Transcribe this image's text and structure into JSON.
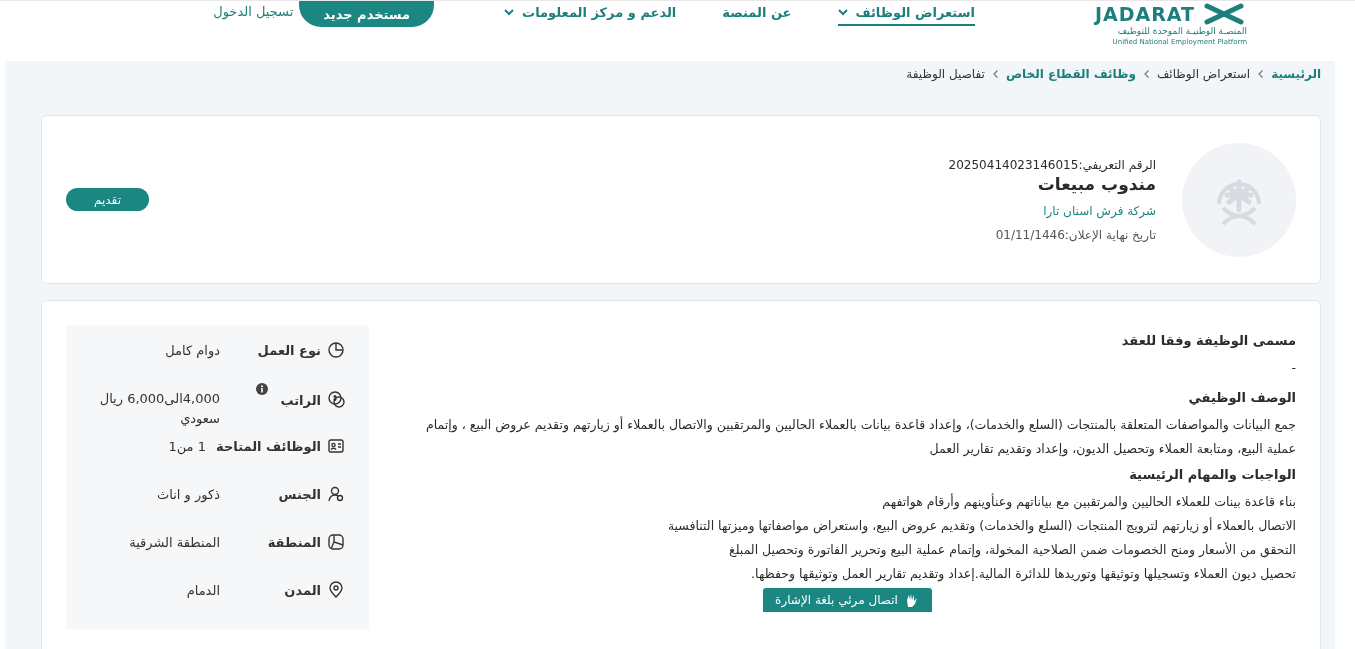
{
  "header": {
    "logo": {
      "wordmark": "JADARAT",
      "arabic": "المنصـة الوطنيـة الموحدة للتوظيف",
      "english": "Unified National Employment Platform"
    },
    "nav": [
      {
        "label": "استعراض الوظائف",
        "dropdown": true,
        "selected": true
      },
      {
        "label": "عن المنصة",
        "dropdown": false,
        "selected": false
      },
      {
        "label": "الدعم و مركز المعلومات",
        "dropdown": true,
        "selected": false
      }
    ],
    "register_button": "مستخدم جديد",
    "login_link": "تسجيل الدخول"
  },
  "breadcrumb": [
    {
      "label": "الرئيسية",
      "link": true
    },
    {
      "label": "استعراض الوظائف",
      "link": false
    },
    {
      "label": "وظائف القطاع الخاص",
      "link": true
    },
    {
      "label": "تفاصيل الوظيفة",
      "link": false
    }
  ],
  "job": {
    "id": "الرقم التعريفي:20250414023146015",
    "title": "مندوب مبيعات",
    "company": "شركة فرش اسنان تارا",
    "deadline": "تاريخ نهاية الإعلان:01/11/1446",
    "apply_button": "تقديم"
  },
  "details": [
    {
      "kind": "work_type",
      "label": "نوع العمل",
      "value": "دوام كامل",
      "info": false
    },
    {
      "kind": "salary",
      "label": "الراتب",
      "value": "4,000الى6,000 ريال سعودي",
      "info": true
    },
    {
      "kind": "vacancies",
      "label": "الوظائف المتاحة",
      "value": "1 من1",
      "info": false
    },
    {
      "kind": "gender",
      "label": "الجنس",
      "value": "ذكور و اناث",
      "info": false
    },
    {
      "kind": "region",
      "label": "المنطقة",
      "value": "المنطقة الشرقية",
      "info": false
    },
    {
      "kind": "city",
      "label": "المدن",
      "value": "الدمام",
      "info": false
    }
  ],
  "sections": [
    {
      "heading": "مسمى الوظيفة وفقا للعقد",
      "lines": [
        "-"
      ]
    },
    {
      "heading": "الوصف الوظيفي",
      "lines": [
        "جمع البيانات والمواصفات المتعلقة بالمنتجات (السلع والخدمات)، وإعداد قاعدة بيانات بالعملاء الحاليين والمرتقبين والاتصال بالعملاء أو زيارتهم وتقديم عروض البيع ، وإتمام عملية البيع، ومتابعة العملاء وتحصيل الديون، وإعداد وتقديم تقارير العمل"
      ]
    },
    {
      "heading": "الواجبات والمهام الرئيسية",
      "lines": [
        "بناء قاعدة بينات للعملاء الحاليين والمرتقبين مع بياناتهم وعنأوينهم وأرقام هواتفهم",
        "الاتصال بالعملاء أو زيارتهم لترويج المنتجات (السلع والخدمات) وتقديم عروض البيع، واستعراض مواصفاتها وميزتها التنافسية",
        "التحقق من الأسعار ومنح الخصومات ضمن الصلاحية المخولة، وإتمام عملية البيع وتحرير الفاتورة وتحصيل المبلغ",
        "تحصيل ديون العملاء وتسجيلها وتوثيقها وتوريدها للدائرة المالية.إعداد وتقديم تقارير العمل وتوثيقها وحفظها."
      ]
    }
  ],
  "sign_language_button": "اتصال مرئي بلغة الإشارة"
}
